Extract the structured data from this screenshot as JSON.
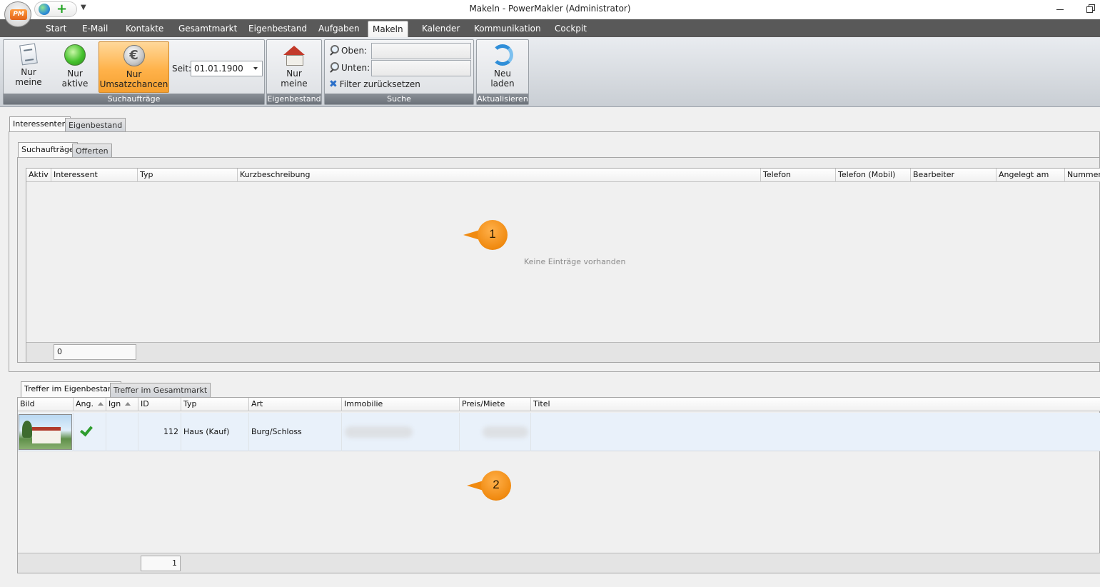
{
  "window": {
    "title": "Makeln - PowerMakler (Administrator)",
    "logo_text": "PM"
  },
  "menu": {
    "tabs": [
      "Start",
      "E-Mail",
      "Kontakte",
      "Gesamtmarkt",
      "Eigenbestand",
      "Aufgaben",
      "Makeln",
      "Kalender",
      "Kommunikation",
      "Cockpit"
    ],
    "active_tab": "Makeln"
  },
  "ribbon": {
    "suchauftraege": {
      "label": "Suchaufträge",
      "nur_meine": [
        "Nur",
        "meine"
      ],
      "nur_aktive": [
        "Nur",
        "aktive"
      ],
      "nur_umsatzchancen": [
        "Nur",
        "Umsatzchancen"
      ],
      "seit_label": "Seit:",
      "seit_value": "01.01.1900"
    },
    "eigenbestand": {
      "label": "Eigenbestand",
      "nur_meine": [
        "Nur",
        "meine"
      ]
    },
    "suche": {
      "label": "Suche",
      "oben_label": "Oben:",
      "unten_label": "Unten:",
      "oben_value": "",
      "unten_value": "",
      "filter_reset": "Filter zurücksetzen"
    },
    "aktualisieren": {
      "label": "Aktualisieren",
      "neu_laden": [
        "Neu",
        "laden"
      ]
    }
  },
  "outer_tabs": [
    "Interessenten",
    "Eigenbestand"
  ],
  "inner_tabs": [
    "Suchaufträge",
    "Offerten"
  ],
  "grid1": {
    "columns": [
      "Aktiv",
      "Interessent",
      "Typ",
      "Kurzbeschreibung",
      "Telefon",
      "Telefon (Mobil)",
      "Bearbeiter",
      "Angelegt am",
      "Nummer"
    ],
    "empty_text": "Keine Einträge vorhanden",
    "footer_count": "0"
  },
  "hit_tabs": [
    "Treffer im Eigenbestand",
    "Treffer im Gesamtmarkt"
  ],
  "grid2": {
    "columns": [
      "Bild",
      "Ang.",
      "Ign",
      "ID",
      "Typ",
      "Art",
      "Immobilie",
      "Preis/Miete",
      "Titel"
    ],
    "rows": [
      {
        "id": "112",
        "typ": "Haus (Kauf)",
        "art": "Burg/Schloss"
      }
    ],
    "footer_count": "1"
  },
  "callouts": [
    "1",
    "2"
  ],
  "colors": {
    "accent": "#f08a10",
    "menubar": "#595959",
    "selected_row": "#e9f1fa"
  }
}
